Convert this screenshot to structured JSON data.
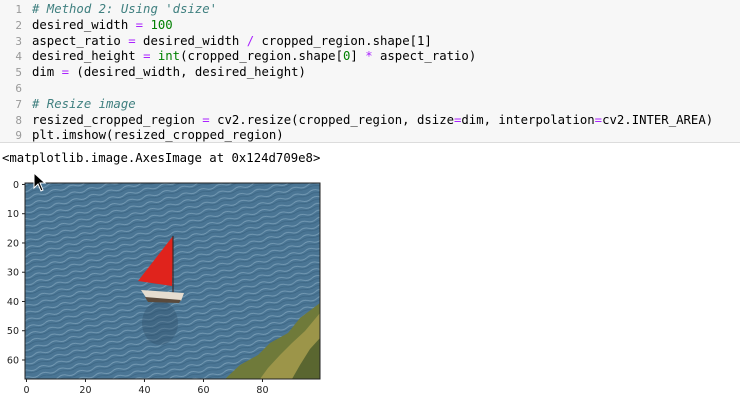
{
  "code_cell": {
    "line_numbers": [
      "1",
      "2",
      "3",
      "4",
      "5",
      "6",
      "7",
      "8",
      "9"
    ],
    "lines": [
      {
        "parts": [
          [
            "cm",
            "# Method 2: Using 'dsize'"
          ]
        ]
      },
      {
        "parts": [
          [
            "t",
            "desired_width "
          ],
          [
            "op",
            "="
          ],
          [
            "t",
            " "
          ],
          [
            "nm",
            "100"
          ]
        ]
      },
      {
        "parts": [
          [
            "t",
            "aspect_ratio "
          ],
          [
            "op",
            "="
          ],
          [
            "t",
            " desired_width "
          ],
          [
            "op",
            "/"
          ],
          [
            "t",
            " cropped_region.shape[1]"
          ]
        ]
      },
      {
        "parts": [
          [
            "t",
            "desired_height "
          ],
          [
            "op",
            "="
          ],
          [
            "t",
            " "
          ],
          [
            "bi",
            "int"
          ],
          [
            "t",
            "(cropped_region.shape["
          ],
          [
            "nm",
            "0"
          ],
          [
            "t",
            "] "
          ],
          [
            "op",
            "*"
          ],
          [
            "t",
            " aspect_ratio)"
          ]
        ]
      },
      {
        "parts": [
          [
            "t",
            "dim "
          ],
          [
            "op",
            "="
          ],
          [
            "t",
            " (desired_width, desired_height)"
          ]
        ]
      },
      {
        "parts": []
      },
      {
        "parts": [
          [
            "cm",
            "# Resize image"
          ]
        ]
      },
      {
        "parts": [
          [
            "t",
            "resized_cropped_region "
          ],
          [
            "op",
            "="
          ],
          [
            "t",
            " cv2.resize(cropped_region, dsize"
          ],
          [
            "op",
            "="
          ],
          [
            "t",
            "dim, interpolation"
          ],
          [
            "op",
            "="
          ],
          [
            "t",
            "cv2.INTER_AREA)"
          ]
        ]
      },
      {
        "parts": [
          [
            "t",
            "plt.imshow(resized_cropped_region)"
          ]
        ]
      }
    ]
  },
  "output": {
    "repr": "<matplotlib.image.AxesImage at 0x124d709e8>"
  },
  "plot": {
    "y_ticks": [
      "0",
      "10",
      "20",
      "30",
      "40",
      "50",
      "60"
    ],
    "x_ticks": [
      "0",
      "20",
      "40",
      "60",
      "80"
    ],
    "image_subject": "red sailboat on blue water with rocky shore"
  },
  "colors": {
    "sail": "#e0231c",
    "water": "#4f7a98",
    "cell_bg": "#f7f7f7"
  }
}
